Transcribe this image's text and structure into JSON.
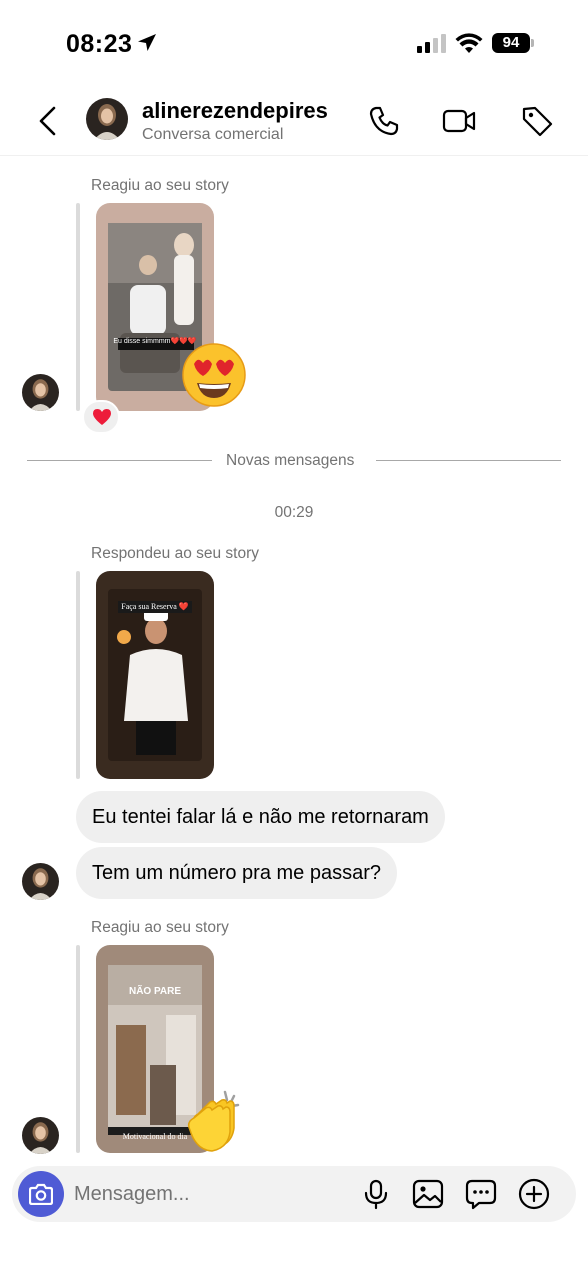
{
  "status_bar": {
    "time": "08:23",
    "battery": "94"
  },
  "header": {
    "username": "alinerezendepires",
    "subtitle": "Conversa comercial"
  },
  "messages": {
    "story_reaction_1": {
      "label": "Reagiu ao seu story",
      "story_caption": "Eu disse simmmm❤️❤️❤️"
    },
    "divider": "Novas mensagens",
    "timestamp": "00:29",
    "story_reply": {
      "label": "Respondeu ao seu story",
      "story_caption": "Faça sua Reserva ❤️"
    },
    "bubbles": [
      "Eu tentei falar lá e não me retornaram",
      "Tem um número pra me passar?"
    ],
    "story_reaction_2": {
      "label": "Reagiu ao seu story",
      "story_title": "NÃO PARE",
      "story_caption": "Motivacional do dia"
    }
  },
  "composer": {
    "placeholder": "Mensagem..."
  },
  "colors": {
    "accent": "#4f5bd5",
    "bubble": "#efefef",
    "secondary_text": "#737373"
  },
  "icons": [
    "location-arrow-icon",
    "signal-icon",
    "wifi-icon",
    "back-icon",
    "phone-icon",
    "video-icon",
    "tag-icon",
    "heart-icon",
    "heart-eyes-emoji",
    "clap-emoji",
    "camera-icon",
    "mic-icon",
    "gallery-icon",
    "sticker-icon",
    "plus-icon"
  ]
}
